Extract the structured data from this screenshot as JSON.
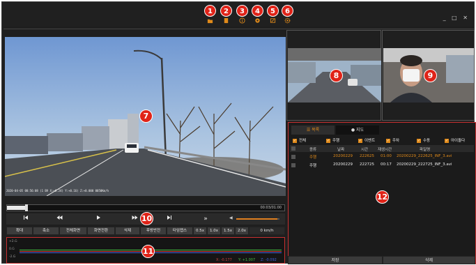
{
  "toolbar": {
    "badges": [
      "1",
      "2",
      "3",
      "4",
      "5",
      "6"
    ],
    "icons": [
      "folder-icon",
      "file-icon",
      "info-icon",
      "map-pin-icon",
      "export-icon",
      "settings-icon"
    ]
  },
  "window": {
    "controls": "_ □ ✕"
  },
  "video": {
    "overlay": "2020-04-05 00:56:08 (1 BV X:+0.24) Y:+0.16) Z:+0.000 0050Km/h",
    "badge": "7"
  },
  "cameras": {
    "front_badge": "8",
    "cabin_badge": "9"
  },
  "playback": {
    "time": "00:03/01:00",
    "progress": 0.07,
    "volume": 0.95,
    "controls_badge": "10",
    "buttons": [
      "확대",
      "축소",
      "전체화면",
      "화면전환",
      "삭제",
      "후방반전",
      "타임랩스",
      "0.5x",
      "1.0x",
      "1.5x",
      "2.0x",
      "0 km/h"
    ]
  },
  "graph": {
    "badge": "11",
    "y_labels": [
      "+2.G",
      "0.G",
      "-2.G"
    ],
    "x_label": "X: -0.177",
    "y_label": "Y: +1.007",
    "z_label": "Z: -0.092",
    "colors": {
      "x": "#d04040",
      "y": "#40c040",
      "z": "#4060e0"
    }
  },
  "list": {
    "tabs": [
      "목록",
      "지도"
    ],
    "filters": [
      "전체",
      "주행",
      "이벤트",
      "주차",
      "수동",
      "아이돌다"
    ],
    "headers": [
      "종류",
      "날짜",
      "시간",
      "재생시간",
      "파일명"
    ],
    "rows": [
      {
        "type": "주행",
        "date": "20200229",
        "time": "222625",
        "duration": "01:00",
        "file": "20200229_222625_INF_3.avi",
        "selected": true
      },
      {
        "type": "주행",
        "date": "20200229",
        "time": "222725",
        "duration": "00:17",
        "file": "20200229_222725_INF_3.avi",
        "selected": false
      }
    ],
    "badge": "12",
    "save_label": "저장",
    "delete_label": "삭제",
    "accent": "#e08a1a"
  }
}
